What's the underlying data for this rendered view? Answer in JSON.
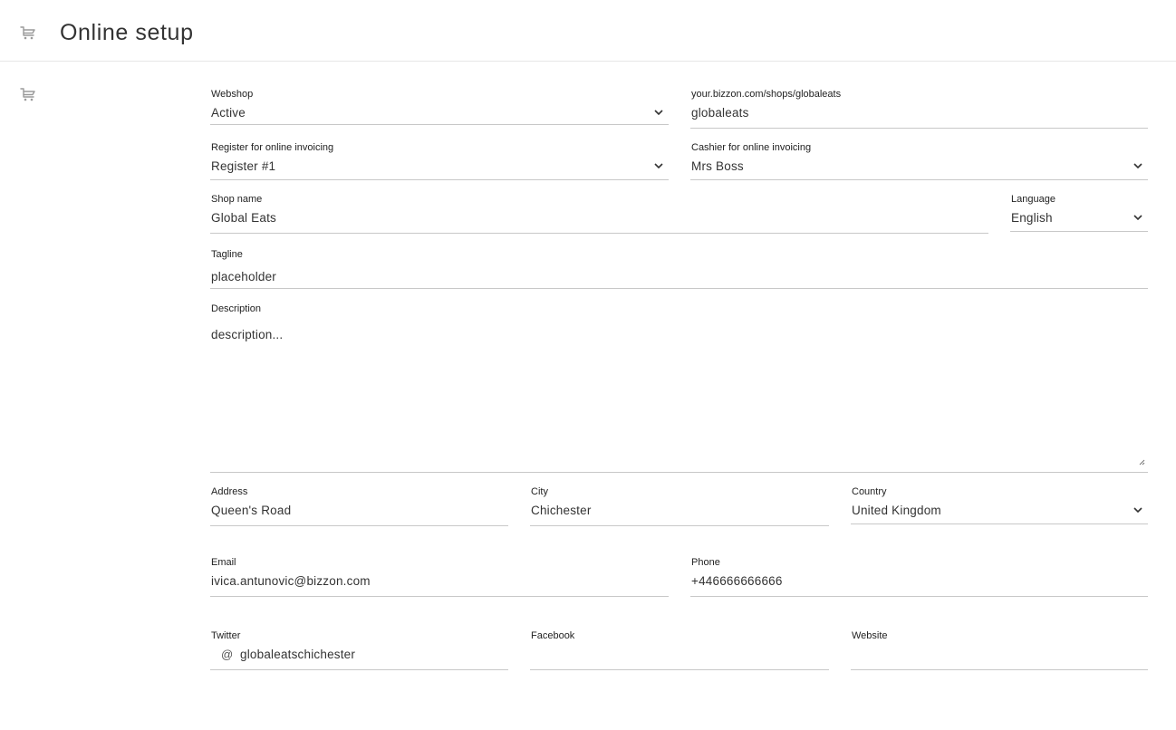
{
  "header": {
    "title": "Online setup",
    "icon": "cart-icon"
  },
  "sidebar": {
    "icon": "cart-icon"
  },
  "form": {
    "webshop": {
      "label": "Webshop",
      "value": "Active"
    },
    "shop_url": {
      "label": "your.bizzon.com/shops/globaleats",
      "value": "globaleats"
    },
    "register": {
      "label": "Register for online invoicing",
      "value": "Register #1"
    },
    "cashier": {
      "label": "Cashier for online invoicing",
      "value": "Mrs Boss"
    },
    "shop_name": {
      "label": "Shop name",
      "value": "Global Eats"
    },
    "language": {
      "label": "Language",
      "value": "English"
    },
    "tagline": {
      "label": "Tagline",
      "value": "placeholder"
    },
    "description": {
      "label": "Description",
      "value": "description..."
    },
    "address": {
      "label": "Address",
      "value": "Queen's Road"
    },
    "city": {
      "label": "City",
      "value": "Chichester"
    },
    "country": {
      "label": "Country",
      "value": "United Kingdom"
    },
    "email": {
      "label": "Email",
      "value": "ivica.antunovic@bizzon.com"
    },
    "phone": {
      "label": "Phone",
      "value": "+446666666666"
    },
    "twitter": {
      "label": "Twitter",
      "prefix": "@",
      "value": "globaleatschichester"
    },
    "facebook": {
      "label": "Facebook",
      "value": ""
    },
    "website": {
      "label": "Website",
      "value": ""
    }
  }
}
